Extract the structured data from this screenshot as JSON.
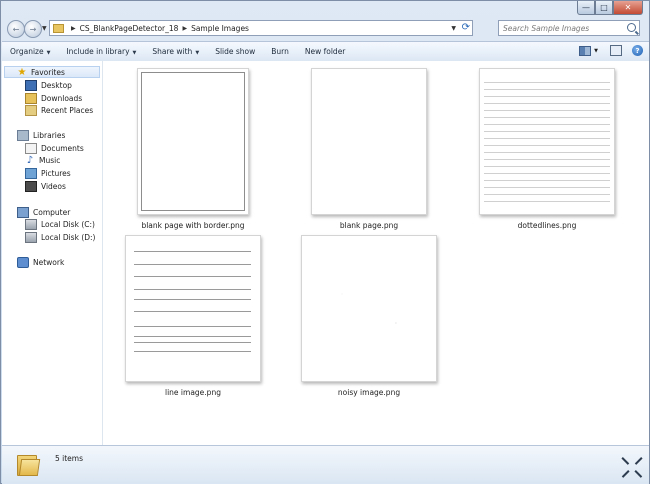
{
  "window": {
    "caption": {
      "minimize": "—",
      "maximize": "□",
      "close": "✕"
    }
  },
  "navigation": {
    "back_glyph": "←",
    "forward_glyph": "→",
    "address": {
      "segments": [
        "CS_BlankPageDetector_18",
        "Sample Images"
      ]
    },
    "search": {
      "placeholder": "Search Sample Images"
    }
  },
  "command_bar": {
    "organize": "Organize",
    "include_in_library": "Include in library",
    "share_with": "Share with",
    "slide_show": "Slide show",
    "burn": "Burn",
    "new_folder": "New folder",
    "help_glyph": "?"
  },
  "sidebar": {
    "favorites": {
      "label": "Favorites",
      "items": [
        {
          "label": "Desktop",
          "icon": "desktop-icon"
        },
        {
          "label": "Downloads",
          "icon": "downloads-icon"
        },
        {
          "label": "Recent Places",
          "icon": "recent-places-icon"
        }
      ]
    },
    "libraries": {
      "label": "Libraries",
      "items": [
        {
          "label": "Documents",
          "icon": "documents-icon"
        },
        {
          "label": "Music",
          "icon": "music-icon"
        },
        {
          "label": "Pictures",
          "icon": "pictures-icon"
        },
        {
          "label": "Videos",
          "icon": "videos-icon"
        }
      ]
    },
    "computer": {
      "label": "Computer",
      "items": [
        {
          "label": "Local Disk (C:)",
          "icon": "disk-icon"
        },
        {
          "label": "Local Disk (D:)",
          "icon": "disk-icon"
        }
      ]
    },
    "network": {
      "label": "Network"
    }
  },
  "files": [
    {
      "name": "blank page with border.png",
      "thumb": "bordered"
    },
    {
      "name": "blank page.png",
      "thumb": "blank"
    },
    {
      "name": "dottedlines.png",
      "thumb": "dotted-lines"
    },
    {
      "name": "line image.png",
      "thumb": "lines"
    },
    {
      "name": "noisy image.png",
      "thumb": "noisy"
    }
  ],
  "details": {
    "item_count": "5 items"
  },
  "colors": {
    "window_frame": "#c8d9ec",
    "selected_bg": "#dbe8f8",
    "close_button": "#c24a33"
  }
}
